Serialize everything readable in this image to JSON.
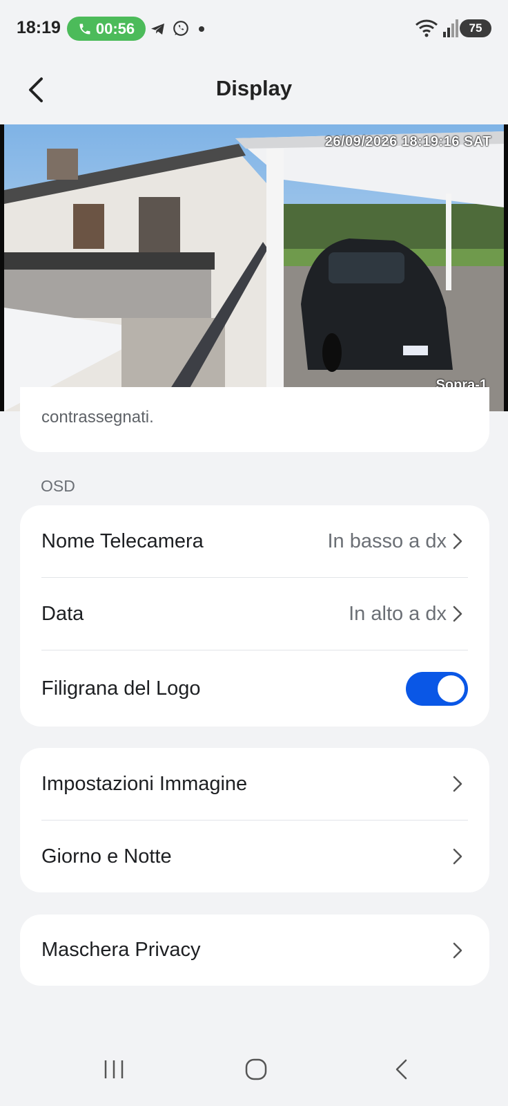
{
  "status_bar": {
    "time": "18:19",
    "call_duration": "00:56",
    "battery": "75",
    "icons": [
      "phone-icon",
      "telegram-icon",
      "whatsapp-icon",
      "dot-icon",
      "wifi-icon",
      "signal-icon"
    ]
  },
  "header": {
    "title": "Display"
  },
  "camera_preview": {
    "osd_date": "26/09/2026 18:19:16 SAT",
    "osd_camera_name": "Sopra-1"
  },
  "partial_card": {
    "text": "contrassegnati."
  },
  "osd_section": {
    "label": "OSD",
    "rows": [
      {
        "label": "Nome Telecamera",
        "value": "In basso a dx"
      },
      {
        "label": "Data",
        "value": "In alto a dx"
      },
      {
        "label": "Filigrana del Logo",
        "toggle_on": true
      }
    ]
  },
  "image_section": {
    "rows": [
      {
        "label": "Impostazioni Immagine"
      },
      {
        "label": "Giorno e Notte"
      }
    ]
  },
  "privacy_section": {
    "rows": [
      {
        "label": "Maschera Privacy"
      }
    ]
  },
  "colors": {
    "accent": "#0a57e6",
    "call_green": "#4cbb5a",
    "background": "#f2f3f5"
  }
}
